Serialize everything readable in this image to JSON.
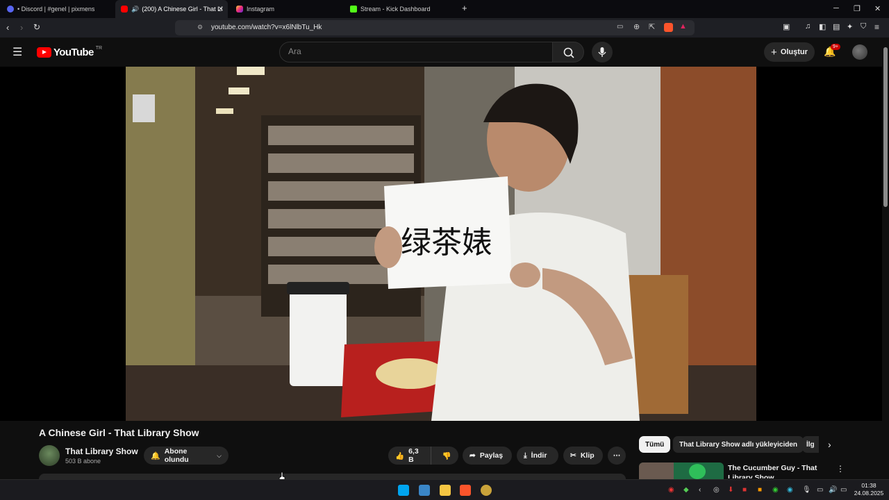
{
  "browser": {
    "tabs": [
      {
        "label": "• Discord | #genel | pixmens",
        "active": false
      },
      {
        "label": "(200) A Chinese Girl - That Li",
        "active": true
      },
      {
        "label": "Instagram",
        "active": false
      },
      {
        "label": "Stream - Kick Dashboard",
        "active": false
      }
    ],
    "url": "youtube.com/watch?v=x6lNlbTu_Hk"
  },
  "youtube": {
    "logo": "YouTube",
    "region": "TR",
    "search_placeholder": "Ara",
    "create_label": "Oluştur",
    "notif_badge": "9+"
  },
  "video": {
    "sign_text": "绿茶婊",
    "title": "A Chinese Girl - That Library Show"
  },
  "channel": {
    "name": "That Library Show",
    "subscribers": "503 B abone",
    "subscribe_label": "Abone olundu"
  },
  "actions": {
    "likes": "6,3 B",
    "share": "Paylaş",
    "download": "İndir",
    "clip": "Klip"
  },
  "chips": [
    "Tümü",
    "That Library Show adlı yükleyiciden",
    "İlg"
  ],
  "recommendation": {
    "title": "The Cucumber Guy - That Library Show"
  },
  "taskbar": {
    "time": "01:38",
    "date": "24.08.2025"
  },
  "colors": {
    "yt_red": "#ff0000",
    "bg": "#0f0f0f",
    "chip_selected": "#f1f1f1"
  }
}
